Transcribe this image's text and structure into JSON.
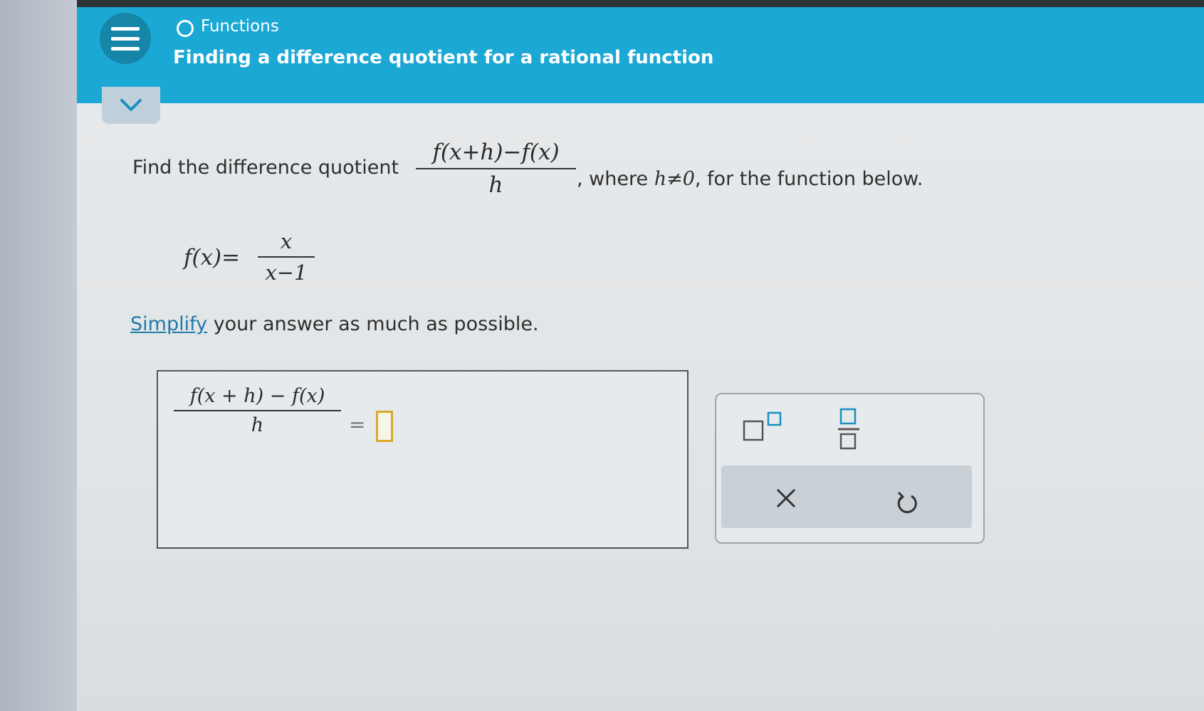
{
  "header": {
    "topic": "Functions",
    "title": "Finding a difference quotient for a rational function"
  },
  "question": {
    "intro": "Find the difference quotient",
    "quotient_numerator": "f(x+h)−f(x)",
    "quotient_denominator": "h",
    "where_text": ", where ",
    "condition": "h≠0",
    "suffix": ", for the function below.",
    "function_lhs": "f(x)=",
    "function_numerator": "x",
    "function_denominator": "x−1",
    "simplify_link": "Simplify",
    "simplify_rest": "your answer as much as possible."
  },
  "answer": {
    "lhs_numerator": "f(x + h) − f(x)",
    "lhs_denominator": "h",
    "equals": "="
  },
  "toolbar": {
    "superscript_icon": "superscript-icon",
    "fraction_icon": "fraction-icon",
    "clear_icon": "close-icon",
    "undo_icon": "undo-icon",
    "clear_symbol": "×"
  },
  "colors": {
    "header": "#1ba8d4",
    "link": "#1f7aa8",
    "answer_slot": "#d9a92b"
  }
}
